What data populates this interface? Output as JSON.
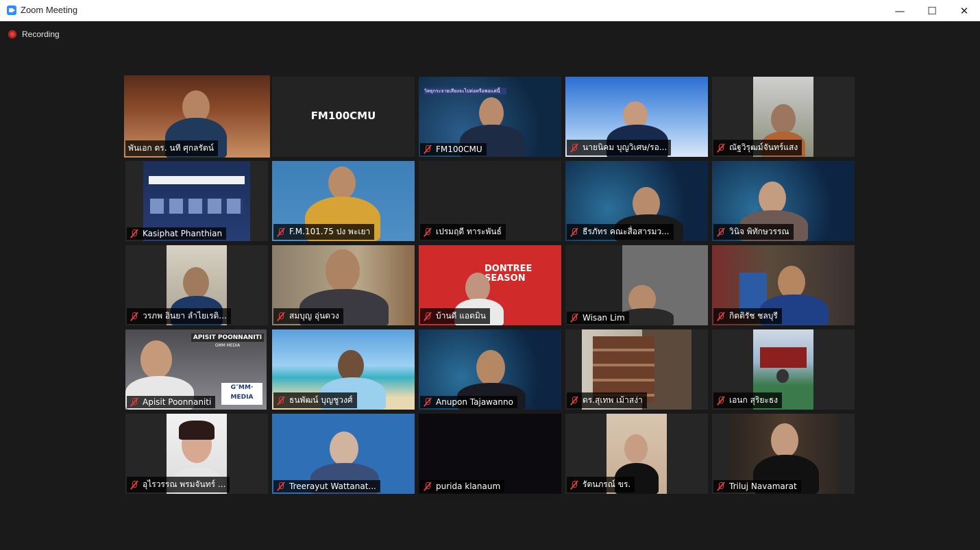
{
  "window": {
    "title": "Zoom Meeting",
    "minimize": "—",
    "maximize": "☐",
    "close": "✕"
  },
  "recording": {
    "label": "Recording"
  },
  "tiles": [
    {
      "name": "พันเอก ดร. นที ศุกลรัตน์",
      "muted": false,
      "active": true
    },
    {
      "name": "FM100CMU",
      "center_label": "FM100CMU",
      "muted": false
    },
    {
      "name": "FM100CMU",
      "muted": true
    },
    {
      "name": "นายนิคม บุญวิเศษ/รอ...",
      "muted": true
    },
    {
      "name": "ณัฐวิรุฒม์จันทร์แสง",
      "muted": true
    },
    {
      "name": "Kasiphat Phanthian",
      "muted": true
    },
    {
      "name": "F.M.101.75 ปง พะเยา",
      "muted": true
    },
    {
      "name": "เปรมฤดี ทาระพันธ์",
      "muted": true
    },
    {
      "name": "ธีรภัทร คณะสื่อสารมว...",
      "muted": true
    },
    {
      "name": "วินิจ พิทักษวรรณ",
      "muted": true
    },
    {
      "name": "วรภพ อินยา ลำไยเรดิ...",
      "muted": true
    },
    {
      "name": "สมบุญ อุ่นดวง",
      "muted": true
    },
    {
      "name": "บ้านดี แอดมิน",
      "muted": true
    },
    {
      "name": "Wisan Lim",
      "muted": true
    },
    {
      "name": "กิตติรัช ชลบุรี",
      "muted": true
    },
    {
      "name": "Apisit Poonnaniti",
      "muted": true
    },
    {
      "name": "ธนพัฒน์ บุญชูวงศ์",
      "muted": true
    },
    {
      "name": "Anupon Tajawanno",
      "muted": true
    },
    {
      "name": "ดร.สุเทพ เม้าสง่า",
      "muted": true
    },
    {
      "name": "เอนก สุริยะธง",
      "muted": true
    },
    {
      "name": "อุไรวรรณ พรมจันทร์ ...",
      "muted": true
    },
    {
      "name": "Treerayut Wattanat...",
      "muted": true
    },
    {
      "name": "purida klanaum",
      "muted": false
    },
    {
      "name": "รัตนภรณ์ ขร.",
      "muted": true
    },
    {
      "name": "Triluj Navamarat",
      "muted": true
    }
  ],
  "overlays": {
    "apisit_banner": "APISIT POONNANITI",
    "apisit_sub": "GMM MEDIA",
    "gmm_logo": "G″MM·\nMEDIA",
    "dontree": "DONTREE SEASON",
    "live_slide": "วิทยุกระจายเสียงจะไปต่อหรือพอแค่นี้"
  },
  "colors": {
    "accent": "#2d8cff",
    "active_border": "#d6e93b",
    "muted": "#e03c3c",
    "bg": "#1a1a1a"
  }
}
